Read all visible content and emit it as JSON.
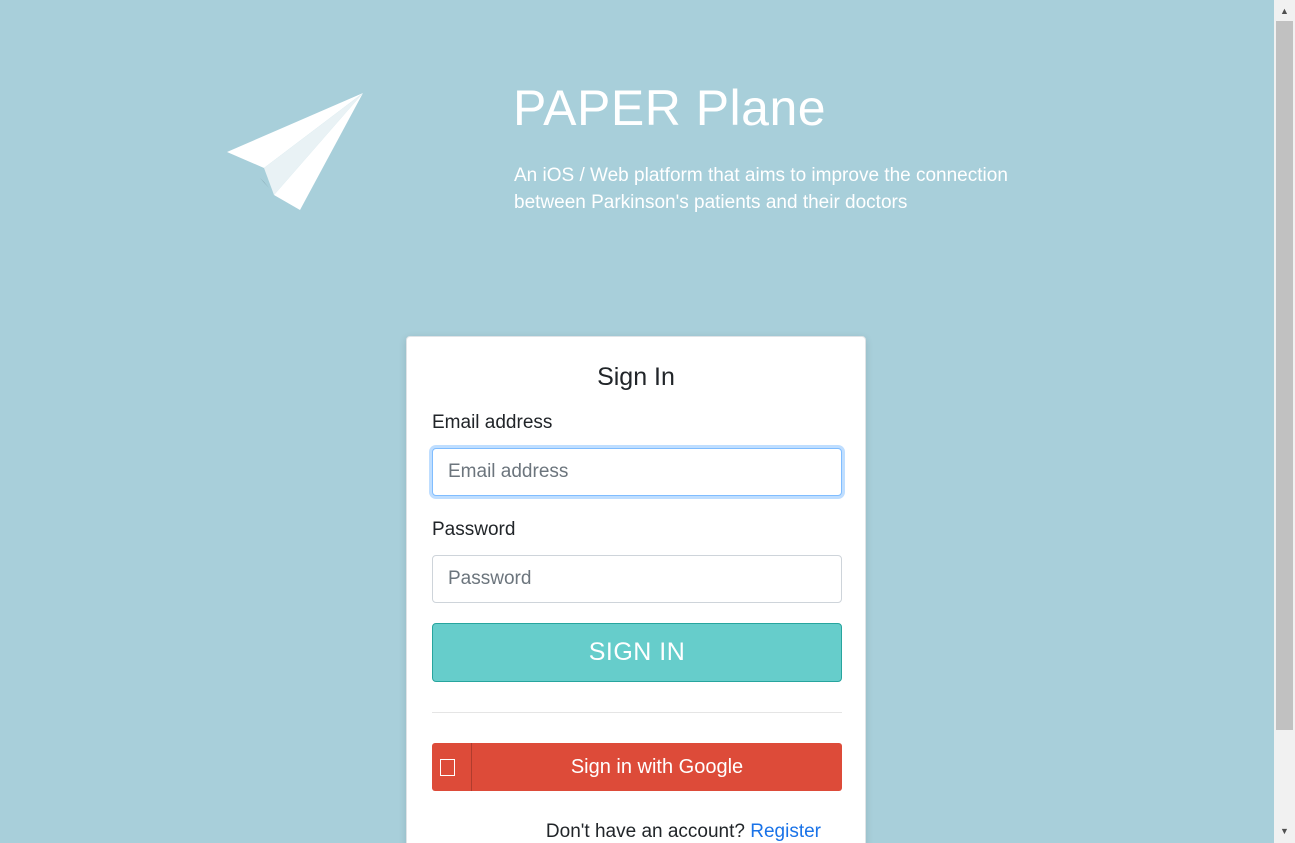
{
  "hero": {
    "logo_icon": "paper-plane-icon",
    "title": "PAPER Plane",
    "tagline_line1": "An iOS / Web platform that aims to improve the connection",
    "tagline_line2": "between Parkinson's patients and their doctors"
  },
  "signin": {
    "title": "Sign In",
    "email_label": "Email address",
    "email_placeholder": "Email address",
    "email_value": "",
    "password_label": "Password",
    "password_placeholder": "Password",
    "password_value": "",
    "submit_label": "SIGN IN",
    "google_label": "Sign in with Google",
    "google_icon": "google-icon",
    "register_prompt": "Don't have an account?",
    "register_link": "Register"
  },
  "colors": {
    "background": "#a8cfda",
    "signin_button": "#66cdcb",
    "google_button": "#dd4b39",
    "link": "#1a73e8"
  }
}
